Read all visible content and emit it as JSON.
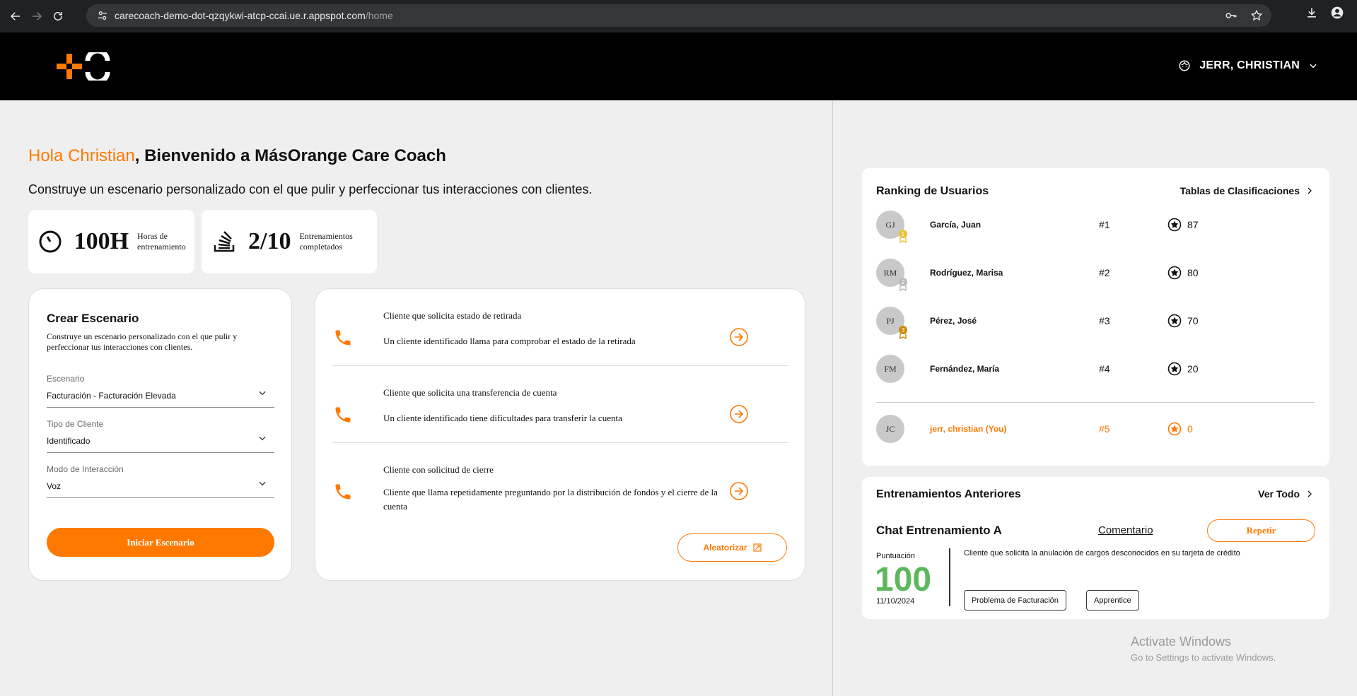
{
  "browser": {
    "url_host": "carecoach-demo-dot-qzqykwi-atcp-ccai.ue.r.appspot.com",
    "url_path": "/home"
  },
  "header": {
    "user_name": "JERR, CHRISTIAN"
  },
  "welcome": {
    "hello": "Hola Christian",
    "rest": ", Bienvenido a MásOrange Care Coach",
    "subtitle": "Construye un escenario personalizado con el que pulir y perfeccionar tus interacciones con clientes."
  },
  "stats": [
    {
      "icon": "clock-icon",
      "value": "100H",
      "label": "Horas de entrenamiento"
    },
    {
      "icon": "stack-icon",
      "value": "2/10",
      "label": "Entrenamientos completados"
    }
  ],
  "create": {
    "title": "Crear Escenario",
    "description": "Construye un escenario personalizado con el que pulir y perfeccionar tus interacciones con clientes.",
    "fields": [
      {
        "label": "Escenario",
        "value": "Facturación - Facturación Elevada"
      },
      {
        "label": "Tipo de Cliente",
        "value": "Identificado"
      },
      {
        "label": "Modo de Interacción",
        "value": "Voz"
      }
    ],
    "button": "Iniciar Escenario"
  },
  "scenarios": {
    "items": [
      {
        "title": "Cliente que solicita estado de retirada",
        "description": "Un cliente identificado llama para comprobar el estado de la retirada"
      },
      {
        "title": "Cliente que solicita una transferencia de cuenta",
        "description": "Un cliente identificado tiene dificultades para transferir la cuenta"
      },
      {
        "title": "Cliente con solicitud de cierre",
        "description": "Cliente que llama repetidamente preguntando por la distribución de fondos y el cierre de la cuenta"
      }
    ],
    "random_button": "Aleatorizar"
  },
  "ranking": {
    "title": "Ranking de Usuarios",
    "link": "Tablas de Clasificaciones",
    "rows": [
      {
        "initials": "GJ",
        "name": "García, Juan",
        "pos": "#1",
        "score": "87",
        "medal": "1"
      },
      {
        "initials": "RM",
        "name": "Rodríguez, Marisa",
        "pos": "#2",
        "score": "80",
        "medal": "2"
      },
      {
        "initials": "PJ",
        "name": "Pérez, José",
        "pos": "#3",
        "score": "70",
        "medal": "3"
      },
      {
        "initials": "FM",
        "name": "Fernández, María",
        "pos": "#4",
        "score": "20"
      }
    ],
    "me": {
      "initials": "JC",
      "name": "jerr, christian (You)",
      "pos": "#5",
      "score": "0"
    }
  },
  "previous": {
    "title": "Entrenamientos Anteriores",
    "link": "Ver Todo",
    "chat_title": "Chat Entrenamiento A",
    "comment": "Comentario",
    "repeat": "Repetir",
    "score_label": "Puntuación",
    "score": "100",
    "date": "11/10/2024",
    "description": "Cliente que solicita la anulación de cargos desconocidos en su tarjeta de crédito",
    "tags": [
      "Problema de Facturación",
      "Apprentice"
    ]
  },
  "watermark": {
    "line1": "Activate Windows",
    "line2": "Go to Settings to activate Windows."
  },
  "colors": {
    "accent": "#ff7900",
    "score": "#5cb85c",
    "gold": "#e8c23a",
    "silver": "#b9b9b9",
    "bronze": "#c98a10"
  }
}
